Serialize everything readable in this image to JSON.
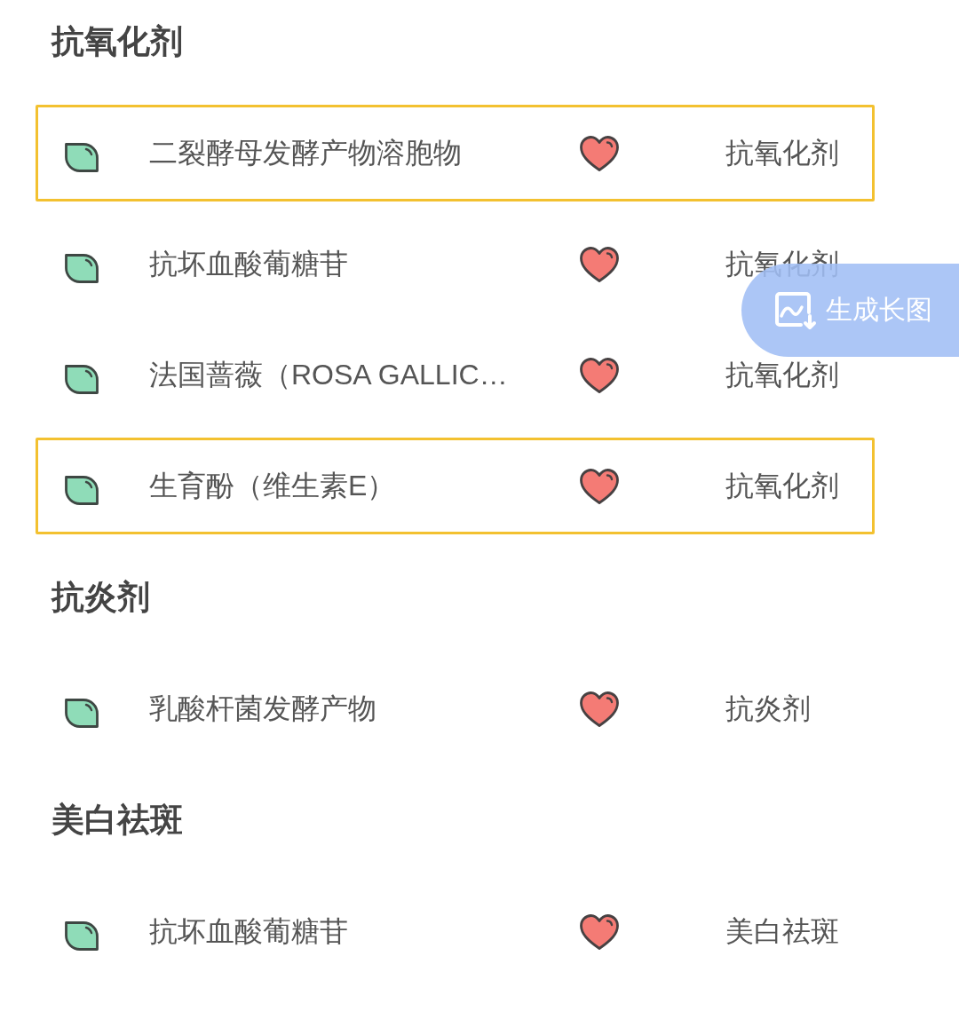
{
  "sections": [
    {
      "title": "抗氧化剂",
      "items": [
        {
          "name": "二裂酵母发酵产物溶胞物",
          "category": "抗氧化剂",
          "selected": true
        },
        {
          "name": "抗坏血酸葡糖苷",
          "category": "抗氧化剂",
          "selected": false
        },
        {
          "name": "法国蔷薇（ROSA GALLIC…",
          "category": "抗氧化剂",
          "selected": false
        },
        {
          "name": "生育酚（维生素E）",
          "category": "抗氧化剂",
          "selected": true
        }
      ]
    },
    {
      "title": "抗炎剂",
      "items": [
        {
          "name": "乳酸杆菌发酵产物",
          "category": "抗炎剂",
          "selected": false
        }
      ]
    },
    {
      "title": "美白祛斑",
      "items": [
        {
          "name": "抗坏血酸葡糖苷",
          "category": "美白祛斑",
          "selected": false
        }
      ]
    }
  ],
  "floating_button": {
    "label": "生成长图"
  }
}
